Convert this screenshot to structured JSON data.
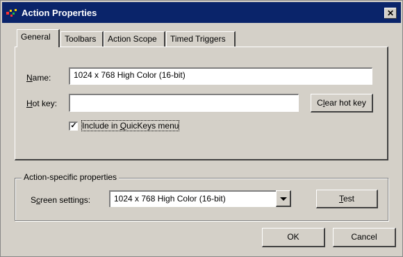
{
  "window": {
    "title": "Action Properties",
    "close_glyph": "✕"
  },
  "tabs": [
    {
      "label": "General",
      "active": true
    },
    {
      "label": "Toolbars",
      "active": false
    },
    {
      "label": "Action Scope",
      "active": false
    },
    {
      "label": "Timed Triggers",
      "active": false
    }
  ],
  "general": {
    "name_label_first": "N",
    "name_label_rest": "ame:",
    "name_value": "1024 x 768 High Color (16-bit)",
    "hotkey_label_first": "H",
    "hotkey_label_rest": "ot key:",
    "hotkey_value": "",
    "clear_hotkey_pre": "C",
    "clear_hotkey_ul": "l",
    "clear_hotkey_post": "ear hot key",
    "include_checkbox_checked": true,
    "include_pre": "Include in ",
    "include_ul": "Q",
    "include_post": "uicKeys menu"
  },
  "action_specific": {
    "group_title": "Action-specific properties",
    "screen_label_pre": "S",
    "screen_label_ul": "c",
    "screen_label_post": "reen settings:",
    "screen_value": "1024 x 768 High Color (16-bit)",
    "test_ul": "T",
    "test_post": "est"
  },
  "footer": {
    "ok_label": "OK",
    "cancel_label": "Cancel"
  },
  "icons": {
    "app": "quickeys-app-icon",
    "close": "close-icon",
    "dropdown": "chevron-down-icon",
    "check": "check-icon"
  }
}
